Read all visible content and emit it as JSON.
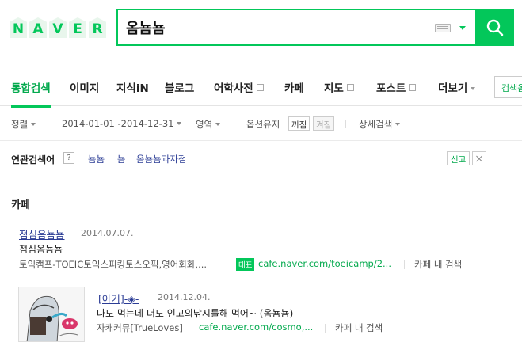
{
  "logo": {
    "letters": [
      "N",
      "A",
      "V",
      "E",
      "R"
    ],
    "color": "#03c75a"
  },
  "search": {
    "query": "옴뇸뇸"
  },
  "tabs": [
    {
      "label": "통합검색",
      "active": true
    },
    {
      "label": "이미지"
    },
    {
      "label": "지식iN"
    },
    {
      "label": "블로그"
    },
    {
      "label": "어학사전",
      "external": true
    },
    {
      "label": "카페"
    },
    {
      "label": "지도",
      "external": true
    },
    {
      "label": "포스트",
      "external": true
    },
    {
      "label": "더보기",
      "dropdown": true
    }
  ],
  "search_option_button": "검색옵",
  "filters": {
    "sort": "정렬",
    "period": "2014-01-01 -2014-12-31",
    "area": "영역",
    "keep_option": "옵션유지",
    "toggle_on": "꺼짐",
    "toggle_off": "켜짐",
    "detail_search": "상세검색"
  },
  "related": {
    "title": "연관검색어",
    "help": "?",
    "keywords": [
      "뇸뇸",
      "뇸",
      "옴뇸뇸과자점"
    ],
    "report": "신고"
  },
  "cafe": {
    "section_title": "카페",
    "results": [
      {
        "title": "점심옴뇸뇸",
        "date": "2014.07.07.",
        "desc": "점심옴뇸뇸",
        "cafe_name": "토익캠프-TOEIC토익스피킹토스오픽,영어회화,...",
        "badge": "대표",
        "url": "cafe.naver.com/toeicamp/2...",
        "in_search": "카페 내 검색"
      },
      {
        "title": "[아기]-◈-",
        "date": "2014.12.04.",
        "desc": "나도 먹는데 너도 인고의낚시를해 먹어~ (옴뇸뇸)",
        "cafe_name": "자캐커뮤[TrueLoves]",
        "url": "cafe.naver.com/cosmo,...",
        "in_search": "카페 내 검색"
      }
    ]
  }
}
